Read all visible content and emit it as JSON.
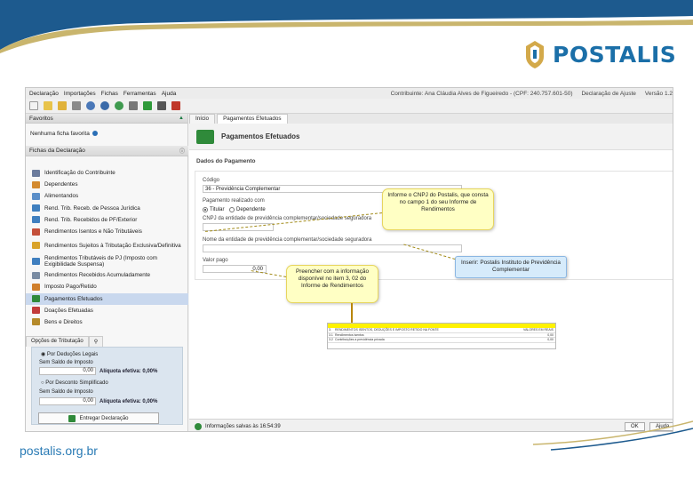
{
  "brand": {
    "name": "POSTALIS",
    "footer_url": "postalis.org.br"
  },
  "menu": [
    "Declaração",
    "Importações",
    "Fichas",
    "Ferramentas",
    "Ajuda"
  ],
  "user": {
    "contribuinte": "Contribuinte: Ana Cláudia Alves de Figueiredo - (CPF: 240.757.601-50)",
    "declaracao": "Declaração de Ajuste",
    "versao": "Versão 1.2"
  },
  "favoritos": {
    "title": "Favoritos",
    "empty": "Nenhuma ficha favorita"
  },
  "fichas": {
    "title": "Fichas da Declaração",
    "items": [
      {
        "label": "Identificação do Contribuinte",
        "color": "#6b7b9c"
      },
      {
        "label": "Dependentes",
        "color": "#d38a2e"
      },
      {
        "label": "Alimentandos",
        "color": "#5b8fc9"
      },
      {
        "label": "Rend. Trib. Receb. de Pessoa Jurídica",
        "color": "#3f7fbf"
      },
      {
        "label": "Rend. Trib. Recebidos de PF/Exterior",
        "color": "#3f7fbf"
      },
      {
        "label": "Rendimentos Isentos e Não Tributáveis",
        "color": "#c4503a"
      },
      {
        "label": "Rendimentos Sujeitos à Tributação Exclusiva/Definitiva",
        "color": "#d9a32a",
        "tall": true
      },
      {
        "label": "Rendimentos Tributáveis de PJ (Imposto com Exigibilidade Suspensa)",
        "color": "#3f7fbf",
        "tall": true
      },
      {
        "label": "Rendimentos Recebidos Acumuladamente",
        "color": "#7a8ca3"
      },
      {
        "label": "Imposto Pago/Retido",
        "color": "#d07f2c"
      },
      {
        "label": "Pagamentos Efetuados",
        "color": "#2f8a3a",
        "active": true
      },
      {
        "label": "Doações Efetuadas",
        "color": "#c23b3b"
      },
      {
        "label": "Bens e Direitos",
        "color": "#b58a2a"
      }
    ]
  },
  "opcoes": {
    "tab1": "Opções de Tributação",
    "legais_label": "Por Deduções Legais",
    "legais_saldo_label": "Sem Saldo de Imposto",
    "legais_saldo": "0,00",
    "legais_aliquota": "Alíquota efetiva: 0,00%",
    "simplificado_label": "Por Desconto Simplificado",
    "simplificado_saldo_label": "Sem Saldo de Imposto",
    "simplificado_saldo": "0,00",
    "simplificado_aliquota": "Alíquota efetiva: 0,00%",
    "entregar": "Entregar Declaração"
  },
  "tabs": [
    "Início",
    "Pagamentos Efetuados"
  ],
  "page": {
    "title": "Pagamentos Efetuados",
    "section": "Dados do Pagamento",
    "codigo_label": "Código",
    "codigo_value": "36 - Previdência Complementar",
    "realizado_label": "Pagamento realizado com",
    "opt_titular": "Titular",
    "opt_dependente": "Dependente",
    "cnpj_label": "CNPJ da entidade de previdência complementar/sociedade seguradora",
    "nome_label": "Nome da entidade de previdência complementar/sociedade seguradora",
    "valor_label": "Valor pago",
    "valor_value": "0,00"
  },
  "status": {
    "text": "Informações salvas às 16:54:39",
    "ok": "OK",
    "ajuda": "Ajuda"
  },
  "callouts": {
    "cnpj": "Informe o CNPJ do Postalis, que consta no campo 1 do seu Informe de Rendimentos",
    "nome": "Inserir: Postalis Instituto de Previdência Complementar",
    "valor": "Preencher com a informação disponível no item 3, 02 do Informe de Rendimentos"
  },
  "doc_snippet": {
    "rows": [
      [
        "3.",
        "RENDIMENTOS ISENTOS, DEDUÇÕES E IMPOSTO RETIDO NA FONTE",
        "VALORES EM REAIS"
      ],
      [
        "3.1",
        "Rendimentos isentos",
        "0,00"
      ],
      [
        "3.2",
        "Contribuições a previdência privada",
        "0,00"
      ]
    ]
  }
}
